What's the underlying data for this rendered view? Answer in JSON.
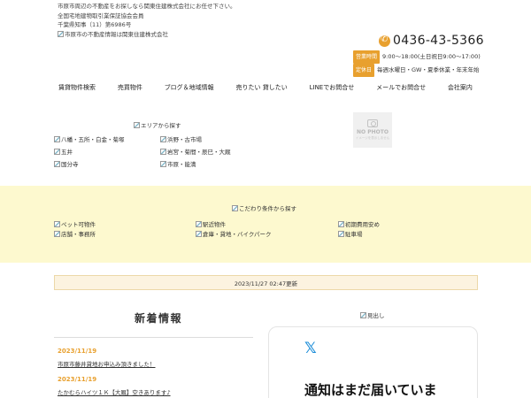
{
  "header": {
    "lines": [
      "市原市周辺の不動産をお探しなら関東住建株式会社にお任せ下さい。",
      "全国宅地建物取引業保証協会会員",
      "千葉県知事（11）第6986号"
    ],
    "logo_alt": "市原市の不動産情報は関東住建株式会社",
    "phone": "0436-43-5366",
    "hours_tag": "営業時間",
    "hours": "9:00～18:00(土日祝日9:00～17:00)",
    "holiday_tag": "定休日",
    "holiday": "毎週水曜日・GW・夏季休業・年末年始"
  },
  "nav": [
    "賃貸物件検索",
    "売買物件",
    "ブログ＆地域情報",
    "売りたい 貸したい",
    "LINEでお問合せ",
    "メールでお問合せ",
    "会社案内"
  ],
  "area": {
    "title": "エリアから探す",
    "left": [
      "八幡・五所・白金・菊塚",
      "五井",
      "国分寺"
    ],
    "right": [
      "浜野・古市場",
      "岩宮・菊間・辰巳・大厩",
      "市原・能満"
    ],
    "no_photo_title": "NO PHOTO",
    "no_photo_sub": "イメージを表示しません"
  },
  "kodawari": {
    "title": "こだわり条件から探す",
    "items": [
      "ペット可物件",
      "駅近物件",
      "初期費用安め",
      "店舗・事務所",
      "倉庫・貸地・バイクパーク",
      "駐車場"
    ]
  },
  "updated": "2023/11/27 02:47更新",
  "news": {
    "title": "新着情報",
    "items": [
      {
        "date": "2023/11/19",
        "text": "市原市藤井貸地お申込み頂きました！"
      },
      {
        "date": "2023/11/19",
        "text": "たかむらハイツ１Ｋ【大厩】空きあります♪"
      }
    ]
  },
  "sidebar": {
    "midashi": "見出し",
    "x_logo": "𝕏",
    "x_notice": "通知はまだ届いていま"
  },
  "colors": {
    "accent": "#e8a02e",
    "band": "#fdf9cf",
    "x_blue": "#1a8cd8"
  }
}
